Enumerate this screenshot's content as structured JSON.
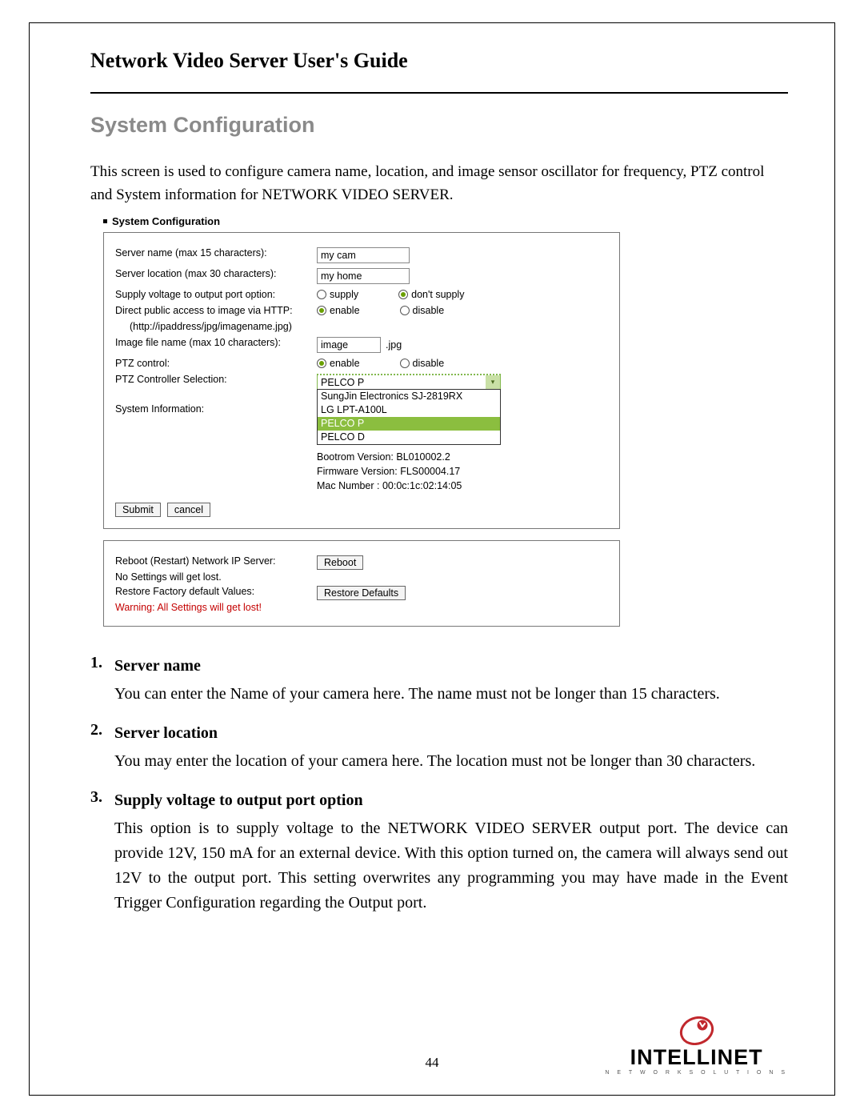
{
  "doc_title": "Network Video Server User's Guide",
  "section_heading": "System Configuration",
  "intro_text": "This screen is used to configure camera name, location, and image sensor oscillator for frequency, PTZ control and System information for NETWORK VIDEO SERVER.",
  "screenshot": {
    "panel_title": "System Configuration",
    "labels": {
      "server_name": "Server name (max 15 characters):",
      "server_location": "Server location (max 30 characters):",
      "supply_voltage": "Supply voltage to output port option:",
      "direct_access": "Direct public access to image via HTTP:",
      "direct_access_sub": "(http://ipaddress/jpg/imagename.jpg)",
      "image_file": "Image file name (max 10 characters):",
      "ptz_control": "PTZ control:",
      "ptz_selection": "PTZ Controller Selection:",
      "sys_info": "System Information:"
    },
    "values": {
      "server_name": "my cam",
      "server_location": "my home",
      "image_file": "image",
      "image_ext": ".jpg"
    },
    "radios": {
      "supply": "supply",
      "dont_supply": "don't supply",
      "enable": "enable",
      "disable": "disable"
    },
    "select_value": "PELCO P",
    "dropdown": {
      "opt1": "SungJin Electronics SJ-2819RX",
      "opt2": "LG LPT-A100L",
      "opt3": "PELCO P",
      "opt4": "PELCO D"
    },
    "sysinfo": {
      "bootrom": "Bootrom Version: BL010002.2",
      "firmware": "Firmware Version: FLS00004.17",
      "mac": "Mac Number : 00:0c:1c:02:14:05"
    },
    "buttons": {
      "submit": "Submit",
      "cancel": "cancel",
      "reboot": "Reboot",
      "restore": "Restore Defaults"
    },
    "panel2": {
      "reboot_label": "Reboot (Restart) Network IP Server:",
      "reboot_sub": "No Settings will get lost.",
      "restore_label": "Restore Factory default Values:",
      "restore_warning": "Warning: All Settings will get lost!"
    }
  },
  "descriptions": [
    {
      "num": "1.",
      "heading": "Server name",
      "body": "You can enter the Name of your camera here. The name must not be longer than 15 characters."
    },
    {
      "num": "2.",
      "heading": "Server location",
      "body": "You may enter the location of your camera here. The location must not be longer than 30 characters."
    },
    {
      "num": "3.",
      "heading": "Supply voltage to output port option",
      "body": "This option is to supply voltage to the NETWORK VIDEO SERVER output port. The device can provide 12V, 150 mA for an external device. With this option turned on, the camera will always send out 12V to the output port. This setting overwrites any programming you may have made in the Event Trigger Configuration regarding the Output port."
    }
  ],
  "page_number": "44",
  "brand": {
    "name": "INTELLINET",
    "tagline": "N E T W O R K   S O L U T I O N S"
  }
}
